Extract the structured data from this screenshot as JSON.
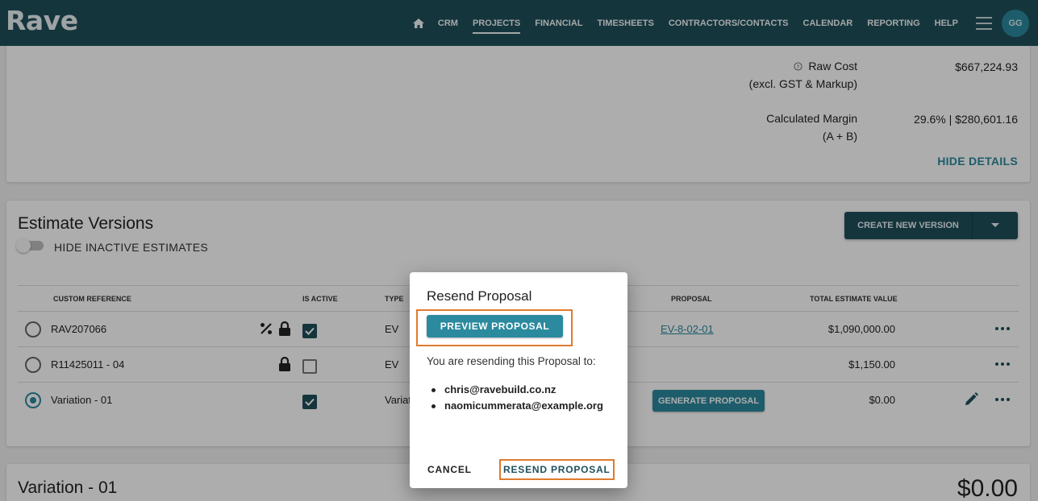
{
  "app": {
    "logo": "Rave"
  },
  "nav": {
    "items": [
      {
        "label": "CRM"
      },
      {
        "label": "PROJECTS",
        "active": true
      },
      {
        "label": "FINANCIAL"
      },
      {
        "label": "TIMESHEETS"
      },
      {
        "label": "CONTRACTORS/CONTACTS"
      },
      {
        "label": "CALENDAR"
      },
      {
        "label": "REPORTING"
      },
      {
        "label": "HELP"
      }
    ],
    "avatar": "GG"
  },
  "costs": {
    "raw_cost_label_1": "Raw Cost",
    "raw_cost_label_2": "(excl. GST & Markup)",
    "raw_cost_value": "$667,224.93",
    "margin_label_1": "Calculated Margin",
    "margin_label_2": "(A + B)",
    "margin_value": "29.6% | $280,601.16",
    "hide_details": "HIDE DETAILS"
  },
  "estimates": {
    "title": "Estimate Versions",
    "toggle_label": "HIDE INACTIVE ESTIMATES",
    "create_button": "CREATE NEW VERSION",
    "columns": {
      "custom_reference": "CUSTOM REFERENCE",
      "is_active": "IS ACTIVE",
      "type": "TYPE",
      "proposal": "PROPOSAL",
      "total": "TOTAL ESTIMATE VALUE"
    },
    "rows": [
      {
        "reference": "RAV207066",
        "type": "EV",
        "proposal": "EV-8-02-01",
        "total": "$1,090,000.00"
      },
      {
        "reference": "R11425011 - 04",
        "type": "EV",
        "proposal": "",
        "total": "$1,150.00"
      },
      {
        "reference": "Variation - 01",
        "type": "Variat",
        "proposal_button": "GENERATE PROPOSAL",
        "total": "$0.00"
      }
    ]
  },
  "variation": {
    "title": "Variation - 01",
    "amount": "$0.00"
  },
  "dialog": {
    "title": "Resend Proposal",
    "preview_button": "PREVIEW PROPOSAL",
    "text": "You are resending this Proposal to:",
    "recipients": [
      "chris@ravebuild.co.nz",
      "naomicummerata@example.org"
    ],
    "cancel_button": "CANCEL",
    "resend_button": "RESEND PROPOSAL"
  },
  "colors": {
    "primary": "#1f4f5b",
    "accent": "#2b8a9e",
    "highlight": "#e07a2c"
  }
}
